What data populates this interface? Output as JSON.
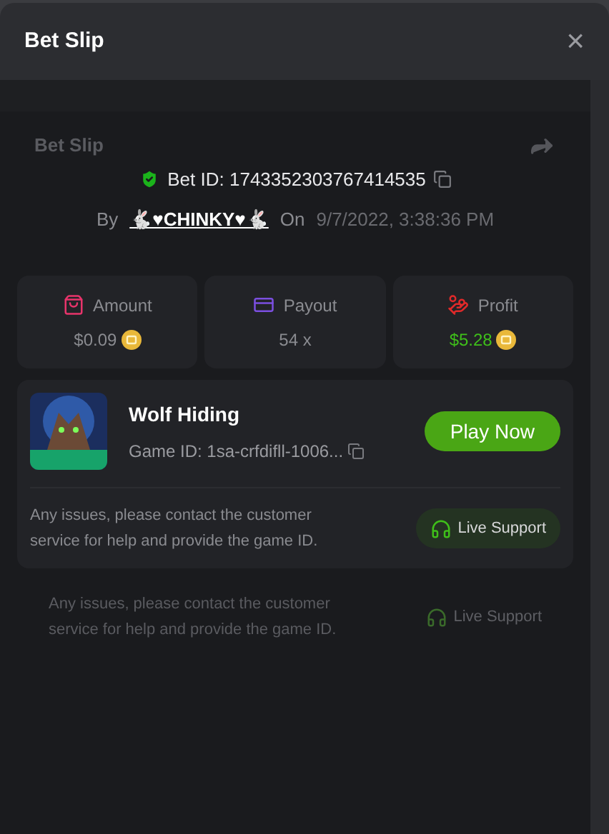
{
  "window": {
    "title": "Bet Slip",
    "close": "×"
  },
  "ghost": {
    "title": "Bet Slip",
    "issues_text": "Any issues, please contact the customer service for help and provide the game ID.",
    "support_button": "Live Support"
  },
  "bet": {
    "id_label": "Bet ID: 1743352303767414535",
    "by_label": "By",
    "user": "🐇♥CHINKY♥🐇",
    "on_label": "On",
    "date": "9/7/2022, 3:38:36 PM"
  },
  "stats": [
    {
      "kind": "amount",
      "label": "Amount",
      "value": "$0.09",
      "coin": true,
      "color": "#e8346b"
    },
    {
      "kind": "payout",
      "label": "Payout",
      "value": "54 x",
      "coin": false,
      "color": "#7b4fe0"
    },
    {
      "kind": "profit",
      "label": "Profit",
      "value": "$5.28",
      "coin": true,
      "color": "#e02a2a"
    }
  ],
  "game": {
    "title": "Wolf Hiding",
    "game_id": "Game ID: 1sa-crfdifll-1006...",
    "play_button": "Play Now"
  },
  "issues_text": "Any issues, please contact the customer service for help and provide the game ID.",
  "support_button": "Live Support"
}
